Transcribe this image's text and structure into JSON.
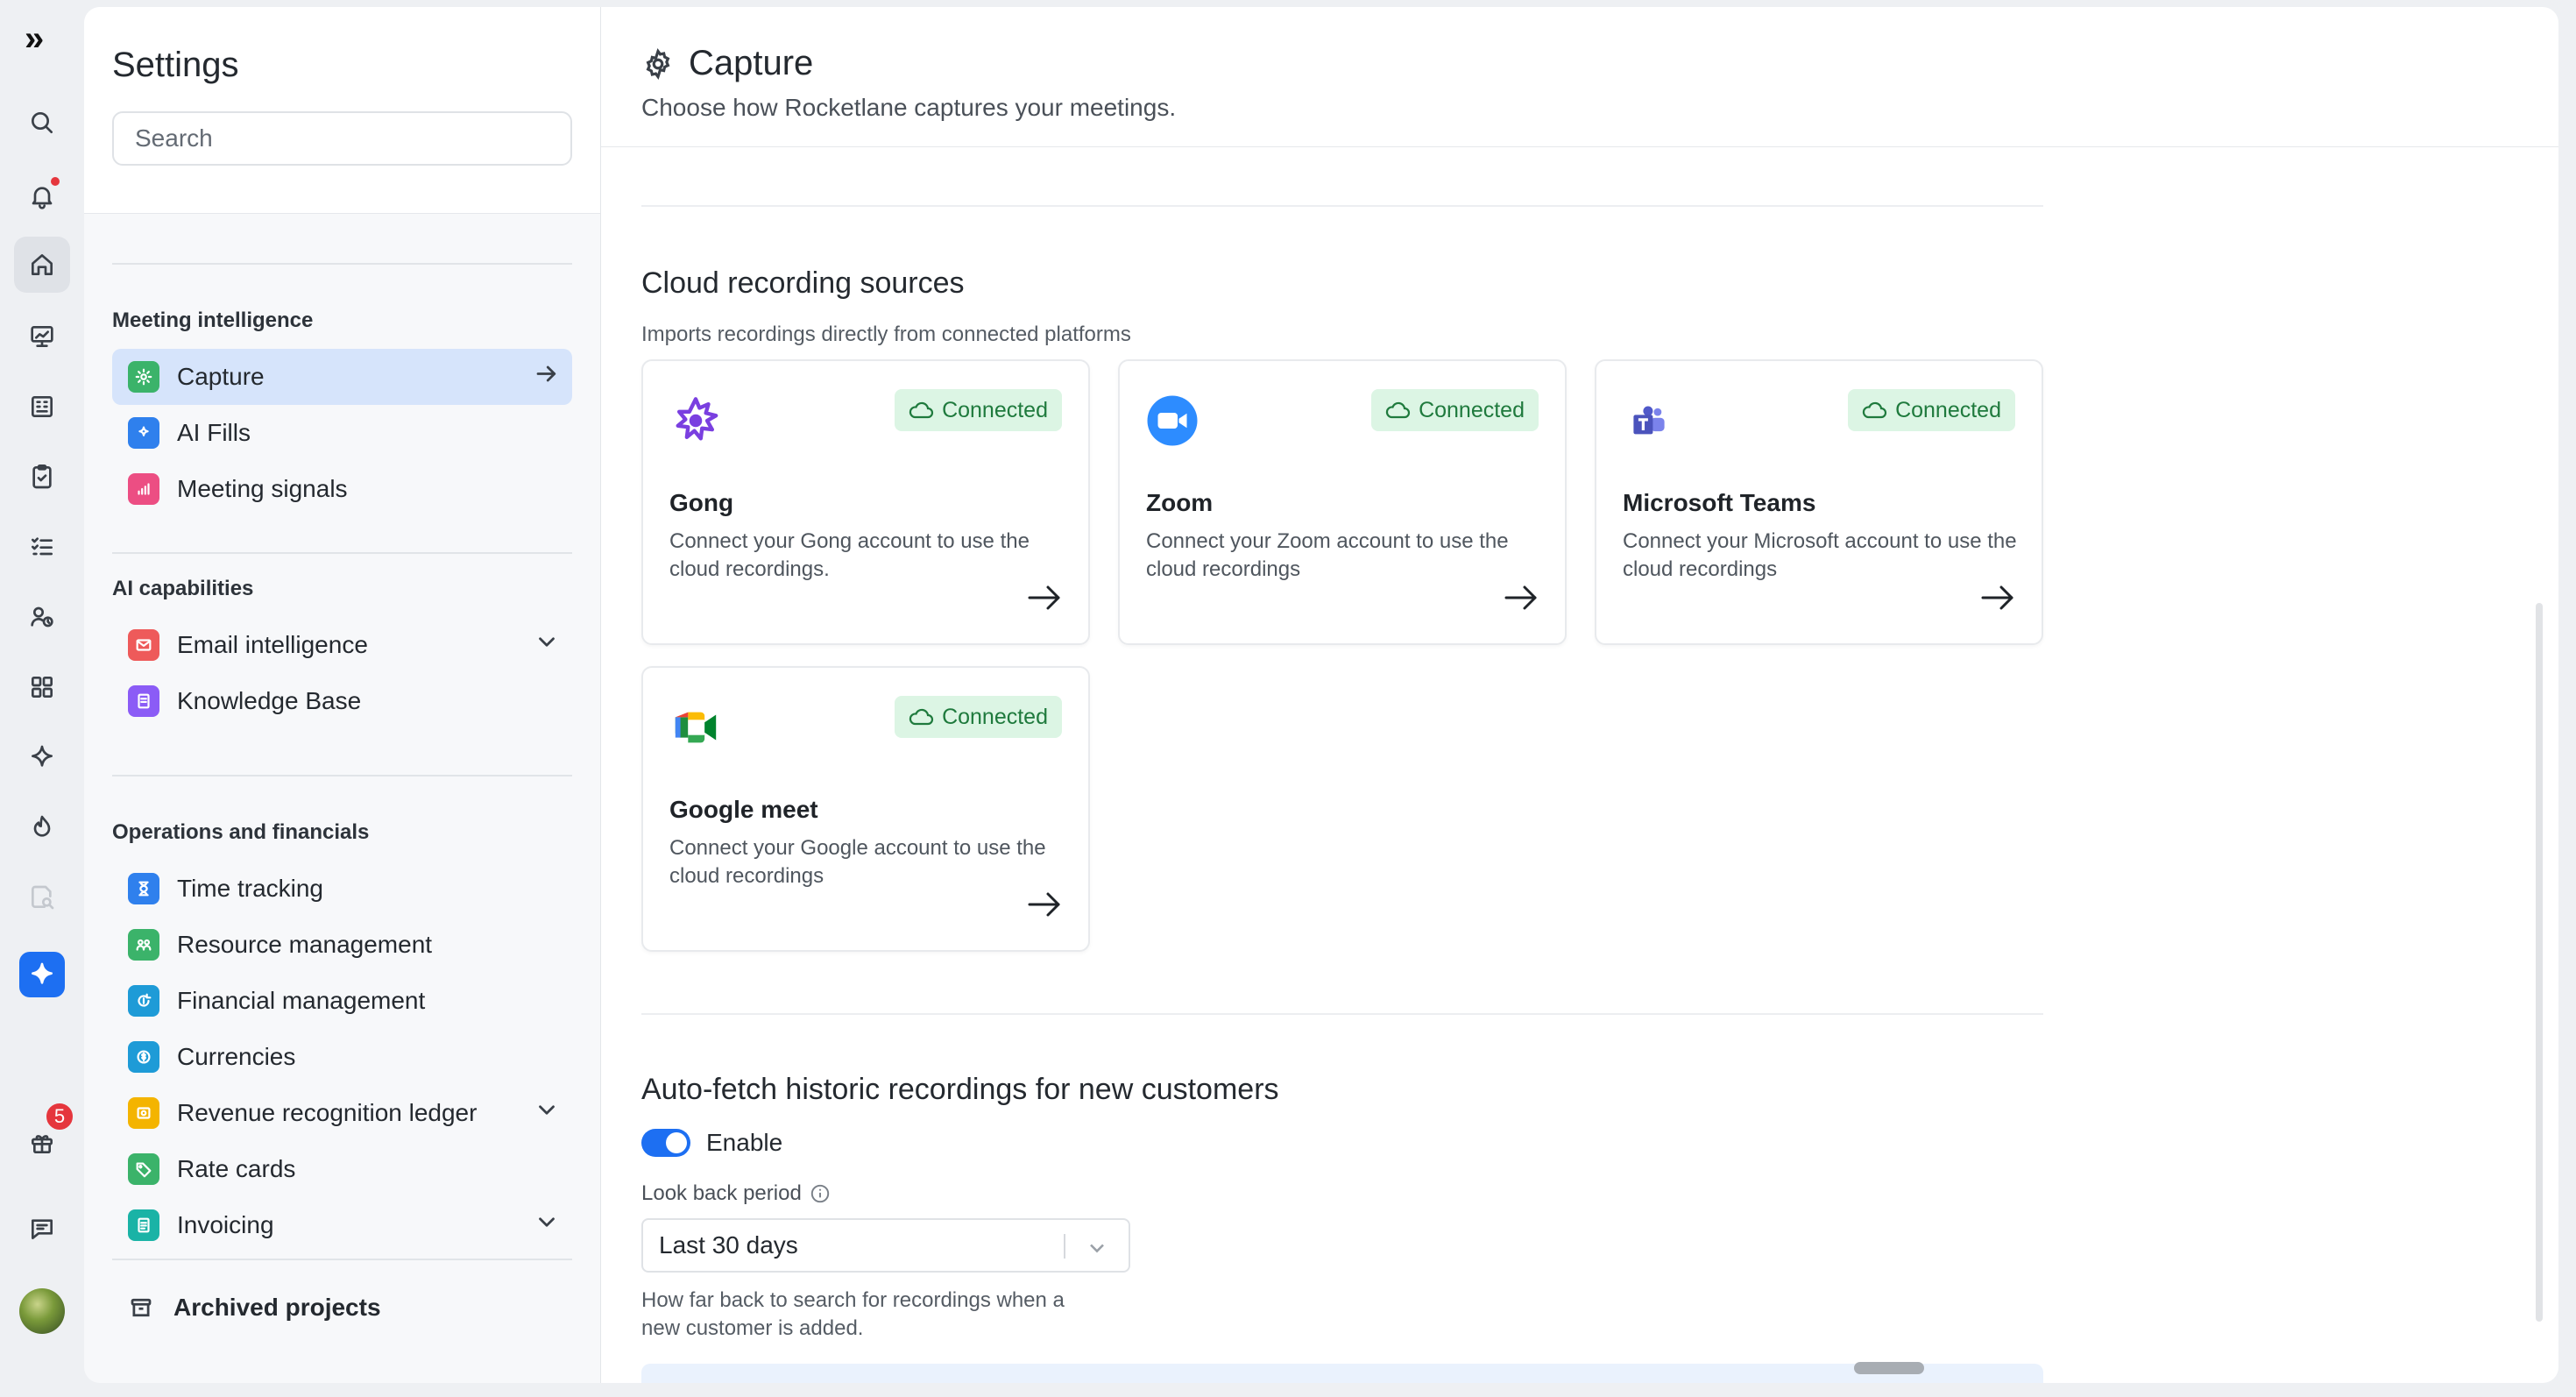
{
  "rail": {
    "logo_text": "»",
    "notification_badge": "5",
    "icons": [
      "search-icon",
      "bell-icon",
      "home-icon",
      "presentation-icon",
      "building-icon",
      "clipboard-icon",
      "checklist-icon",
      "user-clock-icon",
      "grid-icon",
      "sparkle-icon",
      "flame-icon",
      "report-search-icon",
      "ai-sparkle-icon",
      "gift-icon",
      "chat-icon"
    ]
  },
  "settings": {
    "title": "Settings",
    "search_placeholder": "Search",
    "sections": [
      {
        "title": "Meeting intelligence",
        "items": [
          {
            "label": "Capture",
            "active": true,
            "color": "#3bb36a"
          },
          {
            "label": "AI Fills",
            "color": "#2f80ed"
          },
          {
            "label": "Meeting signals",
            "color": "#ec4e83"
          }
        ]
      },
      {
        "title": "AI capabilities",
        "items": [
          {
            "label": "Email intelligence",
            "expandable": true,
            "color": "#ee5a5a"
          },
          {
            "label": "Knowledge Base",
            "color": "#8b5cf6"
          }
        ]
      },
      {
        "title": "Operations and financials",
        "items": [
          {
            "label": "Time tracking",
            "color": "#2f80ed"
          },
          {
            "label": "Resource management",
            "color": "#3bb36a"
          },
          {
            "label": "Financial management",
            "color": "#1e9bd7"
          },
          {
            "label": "Currencies",
            "color": "#1e9bd7"
          },
          {
            "label": "Revenue recognition ledger",
            "expandable": true,
            "color": "#f4b400"
          },
          {
            "label": "Rate cards",
            "color": "#3bb36a"
          },
          {
            "label": "Invoicing",
            "expandable": true,
            "color": "#1ab3a6"
          }
        ]
      }
    ],
    "archived_label": "Archived projects"
  },
  "page": {
    "title": "Capture",
    "subtitle": "Choose how Rocketlane captures your meetings."
  },
  "cloud": {
    "title": "Cloud recording sources",
    "description": "Imports recordings directly from connected platforms",
    "status_label": "Connected",
    "cards": [
      {
        "name": "Gong",
        "desc": "Connect your Gong account to use the cloud recordings."
      },
      {
        "name": "Zoom",
        "desc": "Connect your Zoom account to use the cloud recordings"
      },
      {
        "name": "Microsoft Teams",
        "desc": "Connect your Microsoft account to use the cloud recordings"
      },
      {
        "name": "Google meet",
        "desc": "Connect your Google account to use the cloud recordings"
      }
    ]
  },
  "autofetch": {
    "title": "Auto-fetch historic recordings for new customers",
    "toggle_label": "Enable",
    "toggle_on": true,
    "lookback_label": "Look back period",
    "lookback_value": "Last 30 days",
    "help_line1": "How far back to search for recordings when a",
    "help_line2": "new customer is added."
  },
  "colors": {
    "accent": "#1d6ff2",
    "connected_bg": "#dcf5e4",
    "connected_text": "#1f7a3d",
    "active_nav": "#d6e4fb"
  }
}
